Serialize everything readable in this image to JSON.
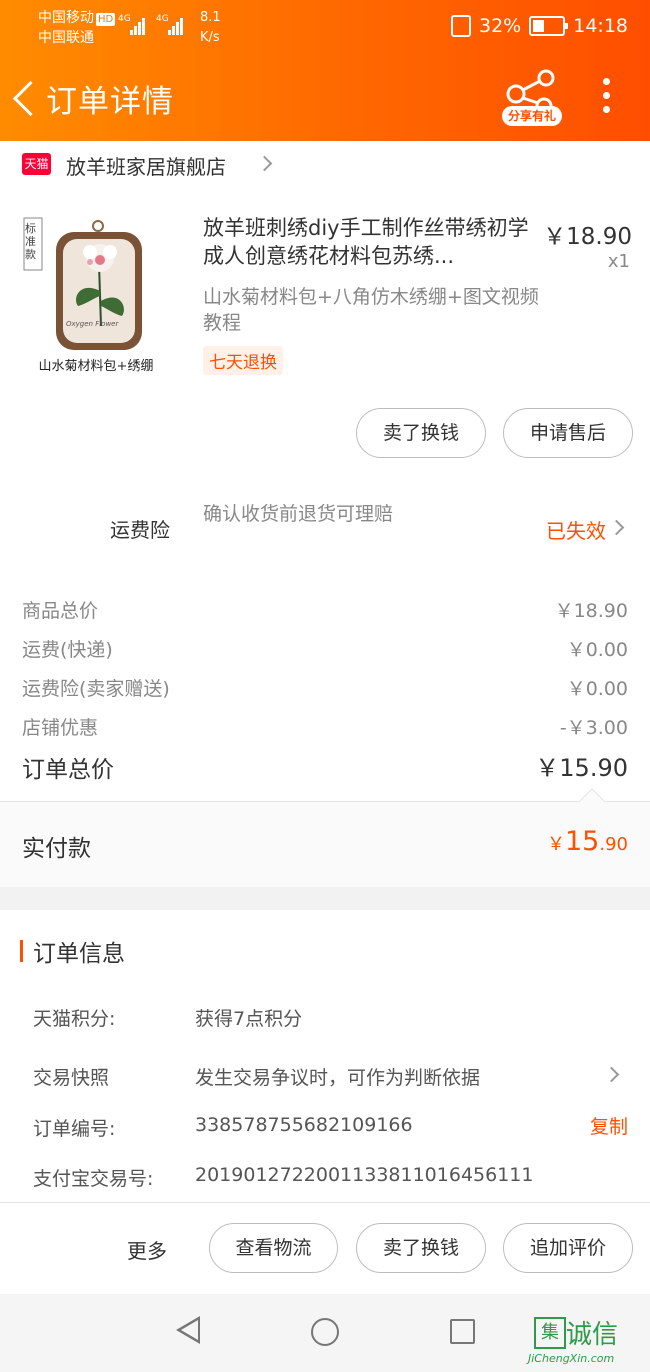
{
  "status_bar": {
    "carrier1": "中国移动",
    "carrier1_badge": "HD",
    "carrier2": "中国联通",
    "net1": "4G",
    "net2": "4G",
    "speed_value": "8.1",
    "speed_unit": "K/s",
    "battery": "32%",
    "time": "14:18"
  },
  "navbar": {
    "title": "订单详情",
    "share_label": "分享有礼"
  },
  "store": {
    "badge": "天猫",
    "name": "放羊班家居旗舰店"
  },
  "product": {
    "thumb_corner": "标准款",
    "thumb_caption": "山水菊材料包+绣绷",
    "thumb_script": "Oxygen Flower",
    "title": "放羊班刺绣diy手工制作丝带绣初学成人创意绣花材料包苏绣...",
    "price": "￥18.90",
    "qty": "x1",
    "sku": "山水菊材料包+八角仿木绣绷+图文视频教程",
    "tag": "七天退换"
  },
  "item_actions": {
    "sell": "卖了换钱",
    "after_sale": "申请售后"
  },
  "insurance": {
    "label": "运费险",
    "desc": "确认收货前退货可理赔",
    "status": "已失效"
  },
  "fees": [
    {
      "label": "商品总价",
      "value": "￥18.90"
    },
    {
      "label": "运费(快递)",
      "value": "￥0.00"
    },
    {
      "label": "运费险(卖家赠送)",
      "value": "￥0.00"
    },
    {
      "label": "店铺优惠",
      "value": "-￥3.00"
    }
  ],
  "total": {
    "label": "订单总价",
    "value": "￥15.90"
  },
  "paid": {
    "label": "实付款",
    "currency": "￥",
    "int": "15",
    "dec": ".90"
  },
  "order_info": {
    "title": "订单信息",
    "rows": [
      {
        "label": "天猫积分:",
        "value": "获得7点积分"
      },
      {
        "label": "交易快照",
        "value": "发生交易争议时，可作为判断依据"
      },
      {
        "label": "订单编号:",
        "value": "338578755682109166"
      },
      {
        "label": "支付宝交易号:",
        "value": "2019012722001133811016456111"
      }
    ],
    "copy": "复制"
  },
  "bottom_bar": {
    "more": "更多",
    "logistics": "查看物流",
    "sell": "卖了换钱",
    "review": "追加评价"
  },
  "watermark": {
    "mark": "集",
    "text": "诚信",
    "url": "JiChengXin.com"
  }
}
